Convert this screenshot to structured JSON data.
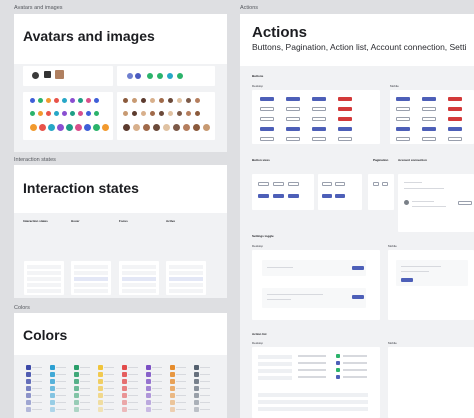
{
  "left_frames": [
    {
      "label": "Avatars and images",
      "title": "Avatars and images"
    },
    {
      "label": "Interaction states",
      "title": "Interaction states",
      "columns": [
        "Interaction states",
        "Hover",
        "Focus",
        "Active"
      ]
    },
    {
      "label": "Colors",
      "title": "Colors"
    }
  ],
  "actions": {
    "label": "Actions",
    "title": "Actions",
    "subtitle": "Buttons, Pagination, Action list, Account connection, Setti",
    "sections": {
      "buttons": "Buttons",
      "desktop": "Desktop",
      "mobile": "Mobile",
      "button_sizes": "Button sizes",
      "pagination": "Pagination",
      "account_connection": "Account connection",
      "settings_toggle": "Settings toggle",
      "action_list": "Action list"
    }
  },
  "colors": {
    "primary": "#4d5fb8",
    "danger": "#d33a3a",
    "avatar_palette": [
      "#3f5fd8",
      "#2bb36b",
      "#f29a2e",
      "#e8534a",
      "#27a7c7",
      "#8a4fd1",
      "#1f9e86",
      "#d94f8b"
    ],
    "swatch_palette": [
      "#3c49a8",
      "#2c9fd2",
      "#2a9e6a",
      "#f0c43a",
      "#e24b4b",
      "#7b4fc4",
      "#e58b2c",
      "#54606e"
    ]
  }
}
